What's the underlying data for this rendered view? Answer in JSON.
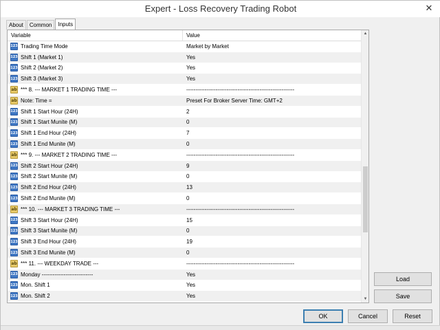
{
  "window": {
    "title": "Expert - Loss Recovery Trading Robot",
    "close_glyph": "✕"
  },
  "tabs": [
    {
      "label": "About"
    },
    {
      "label": "Common"
    },
    {
      "label": "Inputs"
    }
  ],
  "grid": {
    "col_variable": "Variable",
    "col_value": "Value",
    "icon_num_text": "123",
    "icon_str_text": "ab",
    "rows": [
      {
        "type": "num",
        "name": "Trading Time Mode",
        "value": "Market by Market"
      },
      {
        "type": "num",
        "name": "Shift 1 (Market 1)",
        "value": "Yes"
      },
      {
        "type": "num",
        "name": "Shift 2 (Market 2)",
        "value": "Yes"
      },
      {
        "type": "num",
        "name": "Shift 3 (Market 3)",
        "value": "Yes"
      },
      {
        "type": "str",
        "name": "*** 8. --- MARKET 1 TRADING TIME ---",
        "value": "-----------------------------------------------------------"
      },
      {
        "type": "str",
        "name": "Note: Time =",
        "value": "Preset For Broker Server Time: GMT+2"
      },
      {
        "type": "num",
        "name": "Shift 1 Start Hour (24H)",
        "value": "2"
      },
      {
        "type": "num",
        "name": "Shift 1 Start Munite (M)",
        "value": "0"
      },
      {
        "type": "num",
        "name": "Shift 1 End Hour (24H)",
        "value": "7"
      },
      {
        "type": "num",
        "name": "Shift 1 End Munite (M)",
        "value": "0"
      },
      {
        "type": "str",
        "name": "*** 9. --- MARKET 2 TRADING TIME ---",
        "value": "-----------------------------------------------------------"
      },
      {
        "type": "num",
        "name": "Shift 2 Start Hour (24H)",
        "value": "9"
      },
      {
        "type": "num",
        "name": "Shift 2 Start Munite (M)",
        "value": "0"
      },
      {
        "type": "num",
        "name": "Shift 2 End Hour (24H)",
        "value": "13"
      },
      {
        "type": "num",
        "name": "Shift 2 End Munite (M)",
        "value": "0"
      },
      {
        "type": "str",
        "name": "*** 10. --- MARKET 3 TRADING TIME ---",
        "value": "-----------------------------------------------------------"
      },
      {
        "type": "num",
        "name": "Shift 3 Start Hour (24H)",
        "value": "15"
      },
      {
        "type": "num",
        "name": "Shift 3 Start Munite (M)",
        "value": "0"
      },
      {
        "type": "num",
        "name": "Shift 3 End Hour (24H)",
        "value": "19"
      },
      {
        "type": "num",
        "name": "Shift 3 End Munite (M)",
        "value": "0"
      },
      {
        "type": "str",
        "name": "*** 11. --- WEEKDAY TRADE ---",
        "value": "-----------------------------------------------------------"
      },
      {
        "type": "num",
        "name": "Monday ----------------------------",
        "value": "Yes"
      },
      {
        "type": "num",
        "name": "Mon. Shift 1",
        "value": "Yes"
      },
      {
        "type": "num",
        "name": "Mon. Shift 2",
        "value": "Yes"
      }
    ]
  },
  "buttons": {
    "load": "Load",
    "save": "Save",
    "ok": "OK",
    "cancel": "Cancel",
    "reset": "Reset"
  }
}
